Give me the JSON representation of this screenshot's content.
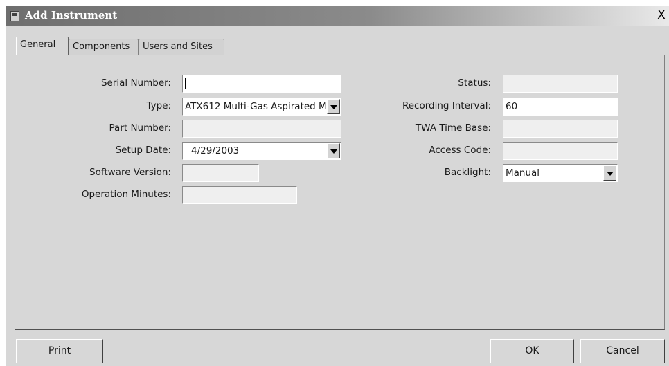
{
  "window": {
    "title": "Add Instrument",
    "close_glyph": "X"
  },
  "tabs": [
    {
      "label": "General",
      "active": true
    },
    {
      "label": "Components",
      "active": false
    },
    {
      "label": "Users and Sites",
      "active": false
    }
  ],
  "left_fields": {
    "serial_number": {
      "label": "Serial Number:",
      "value": ""
    },
    "type": {
      "label": "Type:",
      "value": "ATX612 Multi-Gas Aspirated M"
    },
    "part_number": {
      "label": "Part Number:",
      "value": ""
    },
    "setup_date": {
      "label": "Setup Date:",
      "value": "4/29/2003"
    },
    "software_version": {
      "label": "Software Version:",
      "value": ""
    },
    "operation_minutes": {
      "label": "Operation Minutes:",
      "value": ""
    }
  },
  "right_fields": {
    "status": {
      "label": "Status:",
      "value": ""
    },
    "recording_interval": {
      "label": "Recording Interval:",
      "value": "60"
    },
    "twa_time_base": {
      "label": "TWA Time Base:",
      "value": ""
    },
    "access_code": {
      "label": "Access Code:",
      "value": ""
    },
    "backlight": {
      "label": "Backlight:",
      "value": "Manual"
    }
  },
  "buttons": {
    "print": "Print",
    "ok": "OK",
    "cancel": "Cancel"
  },
  "colors": {
    "window_bg": "#d7d7d7",
    "title_text": "#ffffff",
    "field_bg": "#efefef"
  },
  "icons": {
    "title": "instrument-window-icon",
    "close": "close-icon",
    "dropdown": "chevron-down-icon"
  }
}
